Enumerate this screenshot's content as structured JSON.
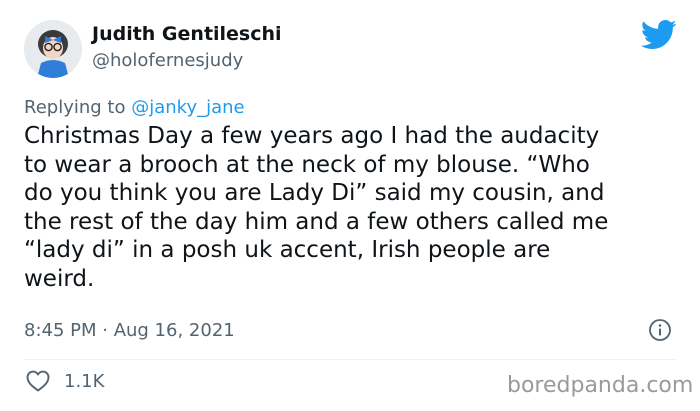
{
  "author": {
    "display_name": "Judith Gentileschi",
    "handle": "@holofernesjudy"
  },
  "reply": {
    "prefix": "Replying to",
    "mention": "@janky_jane"
  },
  "tweet": {
    "text": "Christmas Day a few years ago I had the audacity\nto wear a brooch at the neck of my blouse. “Who\ndo you think you are Lady Di” said my cousin, and\nthe rest of the day him and a few others called me\n“lady di” in a posh uk accent, Irish people are\nweird.",
    "timestamp": "8:45 PM · Aug 16, 2021",
    "likes": "1.1K"
  },
  "watermark": "boredpanda.com",
  "icons": {
    "platform": "twitter-bird-icon",
    "info": "info-icon",
    "like": "heart-icon"
  },
  "colors": {
    "accent": "#1d9bf0",
    "text": "#0f1419",
    "secondary": "#536471"
  }
}
